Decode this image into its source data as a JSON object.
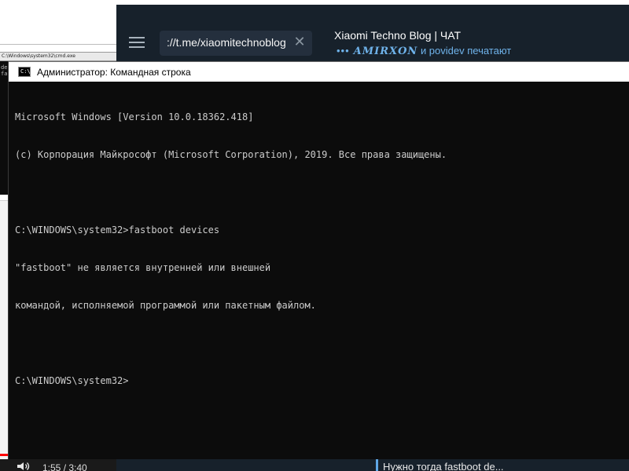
{
  "background": {
    "cmd_title": "C:\\Windows\\system32\\cmd.exe",
    "cmd_snippet": "de\nfa"
  },
  "video": {
    "time": "1:55 / 3:40",
    "progress": 0.52
  },
  "telegram": {
    "search_value": "://t.me/xiaomitechnoblog",
    "chat_title": "Xiaomi Techno Blog | ЧАТ",
    "typing_dots": "•••",
    "typing_name": "𝑨𝑴𝑰𝑹𝑿𝑶𝑵",
    "typing_rest": "и povidev печатают",
    "message_preview": "Нужно тогда fastboot de..."
  },
  "cmd": {
    "title": "Администратор: Командная строка",
    "icon_text": "C:\\",
    "lines": [
      "Microsoft Windows [Version 10.0.18362.418]",
      "(c) Корпорация Майкрософт (Microsoft Corporation), 2019. Все права защищены.",
      "",
      "C:\\WINDOWS\\system32>fastboot devices",
      "\"fastboot\" не является внутренней или внешней",
      "командой, исполняемой программой или пакетным файлом.",
      "",
      "C:\\WINDOWS\\system32>"
    ]
  },
  "colors": {
    "telegram_bg": "#17212b",
    "telegram_accent": "#6fb3eb",
    "console_bg": "#0c0c0c",
    "console_text": "#cccccc"
  }
}
